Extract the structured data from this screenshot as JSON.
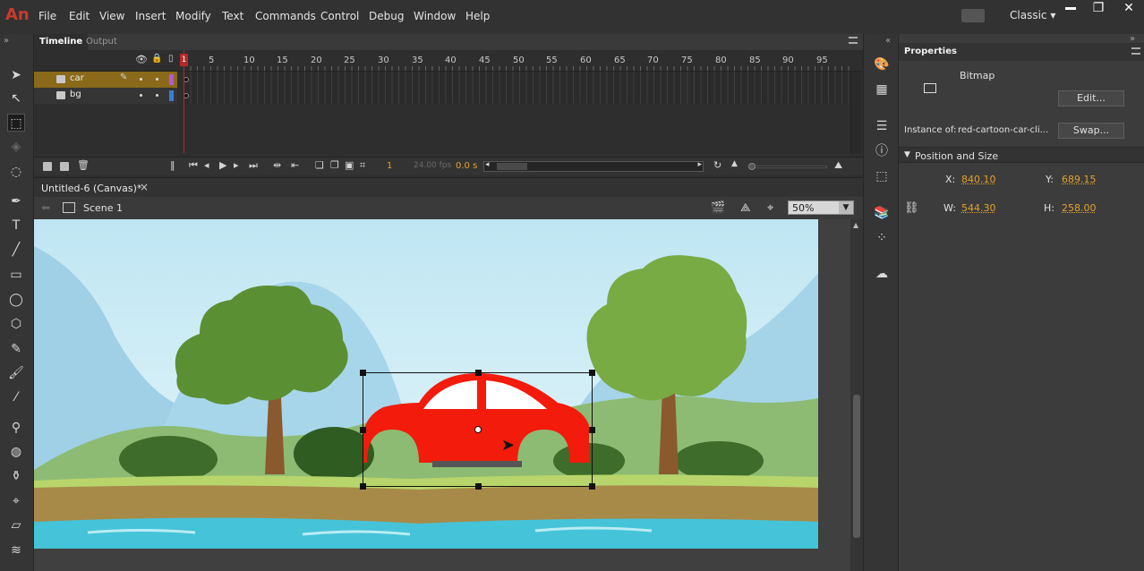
{
  "app": {
    "logo": "An",
    "workspace": "Classic"
  },
  "menu": [
    "File",
    "Edit",
    "View",
    "Insert",
    "Modify",
    "Text",
    "Commands",
    "Control",
    "Debug",
    "Window",
    "Help"
  ],
  "timeline": {
    "tabs": [
      "Timeline",
      "Output"
    ],
    "frame_numbers": [
      "1",
      "5",
      "10",
      "15",
      "20",
      "25",
      "30",
      "35",
      "40",
      "45",
      "50",
      "55",
      "60",
      "65",
      "70",
      "75",
      "80",
      "85",
      "90",
      "95"
    ],
    "layers": [
      {
        "name": "car",
        "color": "#b05bd6",
        "selected": true
      },
      {
        "name": "bg",
        "color": "#3a7bd5",
        "selected": false
      }
    ],
    "current_frame": "1",
    "fps": "24.00 fps",
    "time": "0.0 s"
  },
  "document": {
    "tab_title": "Untitled-6 (Canvas)*",
    "scene": "Scene 1",
    "zoom": "50%"
  },
  "properties": {
    "title": "Properties",
    "type": "Bitmap",
    "edit_button": "Edit...",
    "instance_label": "Instance of:",
    "instance_name": "red-cartoon-car-cli...",
    "swap_button": "Swap...",
    "section": "Position and Size",
    "x_label": "X:",
    "x_value": "840.10",
    "y_label": "Y:",
    "y_value": "689.15",
    "w_label": "W:",
    "w_value": "544.30",
    "h_label": "H:",
    "h_value": "258.00"
  },
  "colors": {
    "accent": "#e1a22c",
    "car": "#f21b0c",
    "playhead": "#b32a2a"
  }
}
